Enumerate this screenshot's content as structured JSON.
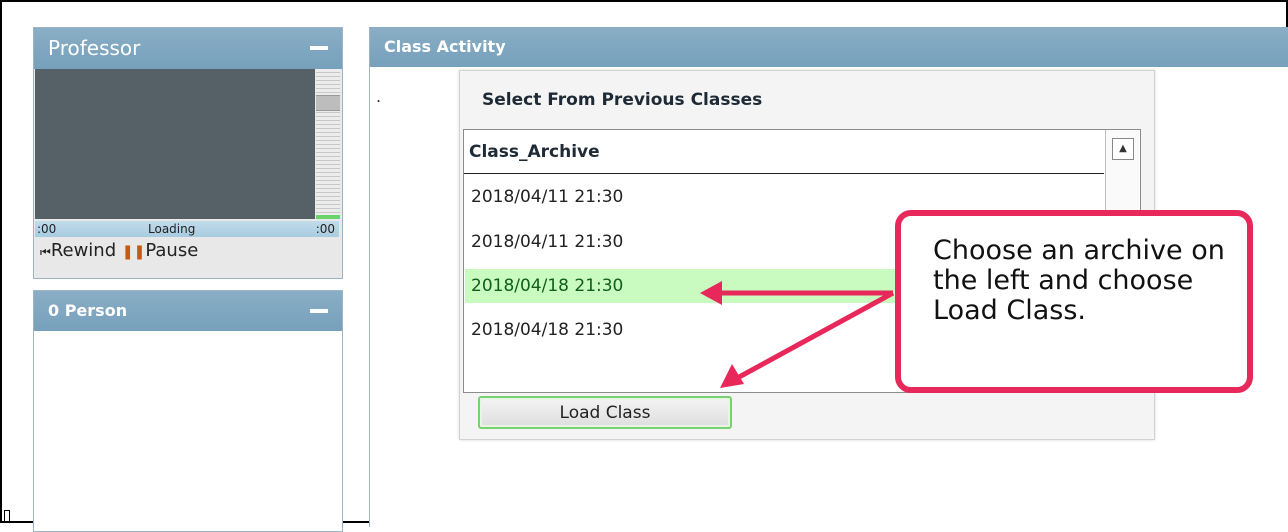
{
  "professor_panel": {
    "title": "Professor",
    "time_start": ":00",
    "time_end": ":00",
    "loading_label": "Loading",
    "rewind_label": "Rewind",
    "pause_label": "Pause"
  },
  "person_panel": {
    "title": "0 Person"
  },
  "activity_panel": {
    "title": "Class Activity",
    "dot": "."
  },
  "dialog": {
    "title": "Select From Previous Classes",
    "column_header": "Class_Archive",
    "rows": [
      "2018/04/11 21:30",
      "2018/04/11 21:30",
      "2018/04/18 21:30",
      "2018/04/18 21:30"
    ],
    "selected_index": 2,
    "load_button": "Load Class"
  },
  "callout": {
    "text": "Choose an archive on the left and choose Load Class.",
    "border_color": "#e8285a"
  },
  "icons": [
    "minimize-icon",
    "rewind-icon",
    "pause-icon",
    "scroll-up-icon",
    "arrow-icon"
  ]
}
